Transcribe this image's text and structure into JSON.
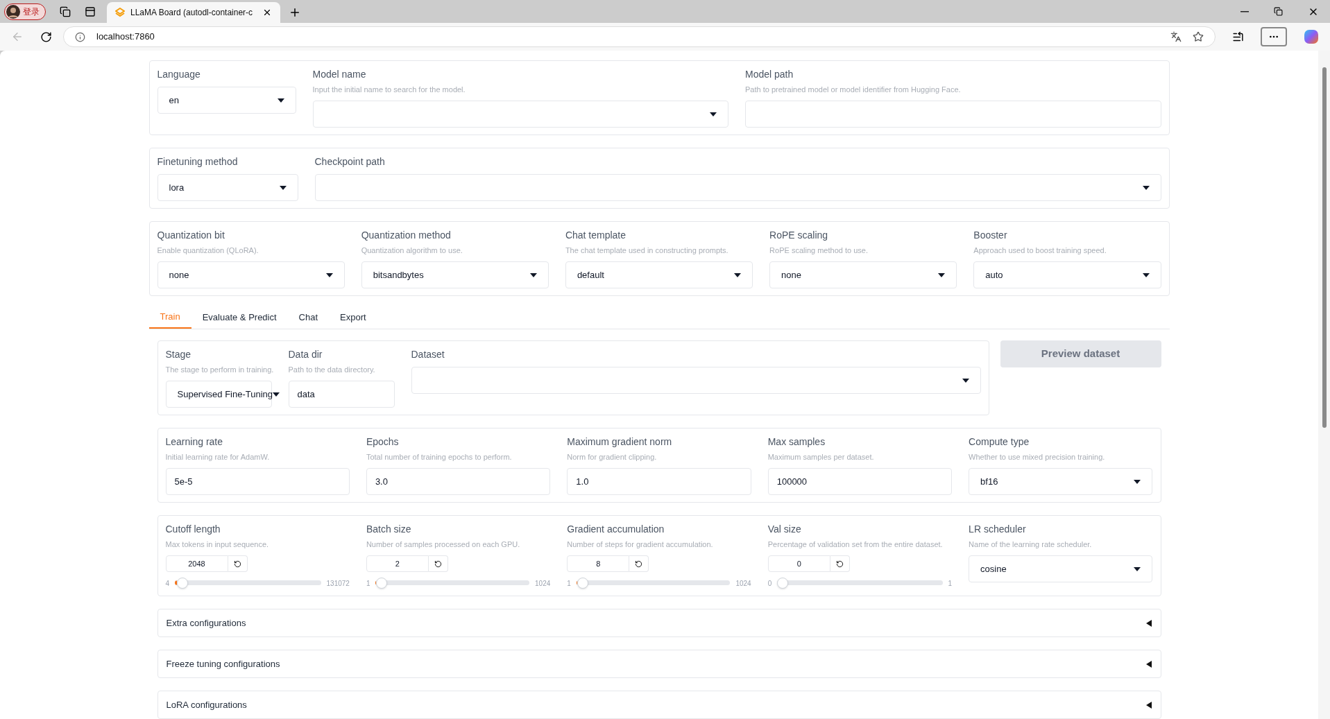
{
  "browser": {
    "profile": "登录",
    "tab_title": "LLaMA Board (autodl-container-c",
    "address": "localhost:7860"
  },
  "top_row": [
    {
      "kind": "dropdown",
      "label": "Language",
      "value": "en"
    },
    {
      "kind": "dropdown",
      "label": "Model name",
      "hint": "Input the initial name to search for the model."
    },
    {
      "kind": "text",
      "label": "Model path",
      "hint": "Path to pretrained model or model identifier from Hugging Face."
    }
  ],
  "method_row": [
    {
      "kind": "dropdown",
      "label": "Finetuning method",
      "value": "lora"
    },
    {
      "kind": "dropdown",
      "label": "Checkpoint path"
    }
  ],
  "advanced_row": [
    {
      "kind": "dropdown",
      "label": "Quantization bit",
      "hint": "Enable quantization (QLoRA).",
      "value": "none"
    },
    {
      "kind": "dropdown",
      "label": "Quantization method",
      "hint": "Quantization algorithm to use.",
      "value": "bitsandbytes"
    },
    {
      "kind": "dropdown",
      "label": "Chat template",
      "hint": "The chat template used in constructing prompts.",
      "value": "default"
    },
    {
      "kind": "dropdown",
      "label": "RoPE scaling",
      "hint": "RoPE scaling method to use.",
      "value": "none"
    },
    {
      "kind": "dropdown",
      "label": "Booster",
      "hint": "Approach used to boost training speed.",
      "value": "auto"
    }
  ],
  "tabs": [
    {
      "label": "Train",
      "selected": true
    },
    {
      "label": "Evaluate & Predict",
      "selected": false
    },
    {
      "label": "Chat",
      "selected": false
    },
    {
      "label": "Export",
      "selected": false
    }
  ],
  "data_row": [
    {
      "kind": "dropdown",
      "label": "Stage",
      "hint": "The stage to perform in training.",
      "value": "Supervised Fine-Tuning"
    },
    {
      "kind": "text",
      "label": "Data dir",
      "hint": "Path to the data directory.",
      "value": "data"
    },
    {
      "kind": "dropdown",
      "label": "Dataset"
    }
  ],
  "preview_button": "Preview dataset",
  "hyper_row": [
    {
      "kind": "text",
      "label": "Learning rate",
      "hint": "Initial learning rate for AdamW.",
      "value": "5e-5"
    },
    {
      "kind": "text",
      "label": "Epochs",
      "hint": "Total number of training epochs to perform.",
      "value": "3.0"
    },
    {
      "kind": "text",
      "label": "Maximum gradient norm",
      "hint": "Norm for gradient clipping.",
      "value": "1.0"
    },
    {
      "kind": "text",
      "label": "Max samples",
      "hint": "Maximum samples per dataset.",
      "value": "100000"
    },
    {
      "kind": "dropdown",
      "label": "Compute type",
      "hint": "Whether to use mixed precision training.",
      "value": "bf16"
    }
  ],
  "slider_row": [
    {
      "kind": "slider",
      "label": "Cutoff length",
      "hint": "Max tokens in input sequence.",
      "value": "2048",
      "min": "4",
      "max": "131072",
      "level": 0.016
    },
    {
      "kind": "slider",
      "label": "Batch size",
      "hint": "Number of samples processed on each GPU.",
      "value": "2",
      "min": "1",
      "max": "1024",
      "level": 0.001
    },
    {
      "kind": "slider",
      "label": "Gradient accumulation",
      "hint": "Number of steps for gradient accumulation.",
      "value": "8",
      "min": "1",
      "max": "1024",
      "level": 0.007
    },
    {
      "kind": "slider",
      "label": "Val size",
      "hint": "Percentage of validation set from the entire dataset.",
      "value": "0",
      "min": "0",
      "max": "1",
      "level": 0
    },
    {
      "kind": "dropdown",
      "label": "LR scheduler",
      "hint": "Name of the learning rate scheduler.",
      "value": "cosine"
    }
  ],
  "accordions": [
    {
      "label": "Extra configurations",
      "expanded": false
    },
    {
      "label": "Freeze tuning configurations",
      "expanded": false
    },
    {
      "label": "LoRA configurations",
      "expanded": false
    }
  ]
}
